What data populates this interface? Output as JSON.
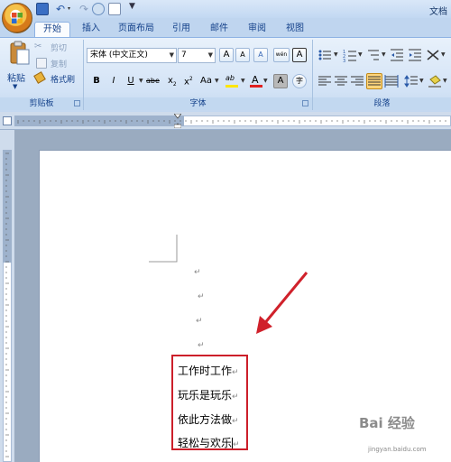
{
  "quick_access": {
    "more_label": "▼"
  },
  "window": {
    "title": "文档"
  },
  "tabs": [
    {
      "label": "开始"
    },
    {
      "label": "插入"
    },
    {
      "label": "页面布局"
    },
    {
      "label": "引用"
    },
    {
      "label": "邮件"
    },
    {
      "label": "审阅"
    },
    {
      "label": "视图"
    }
  ],
  "clipboard": {
    "paste_label": "粘贴",
    "cut_label": "剪切",
    "copy_label": "复制",
    "format_painter_label": "格式刷",
    "group_label": "剪贴板"
  },
  "font": {
    "font_name": "宋体 (中文正文)",
    "font_size": "7",
    "group_label": "字体",
    "grow_label": "A",
    "shrink_label": "A",
    "bold_label": "B",
    "italic_label": "I",
    "underline_label": "U",
    "strike_label": "abe",
    "subscript_label": "x",
    "superscript_label": "x",
    "case_label": "Aa",
    "highlight_label": "ab",
    "color_label": "A",
    "shade_label": "A",
    "clear_label": "A",
    "wen_label": "wén",
    "char_border_label": "A",
    "enclose_label": "字",
    "highlight_color": "#ffe600",
    "font_color": "#e02020"
  },
  "paragraph": {
    "group_label": "段落"
  },
  "document": {
    "lines": [
      "工作时工作",
      "玩乐是玩乐",
      "依此方法做",
      "轻松与欢乐"
    ],
    "paragraph_mark": "↵"
  },
  "watermark": {
    "text": "Bai 经验",
    "sub": "jingyan.baidu.com"
  },
  "colors": {
    "annotation": "#cc1f2a",
    "ribbon": "#d3e3f6"
  }
}
